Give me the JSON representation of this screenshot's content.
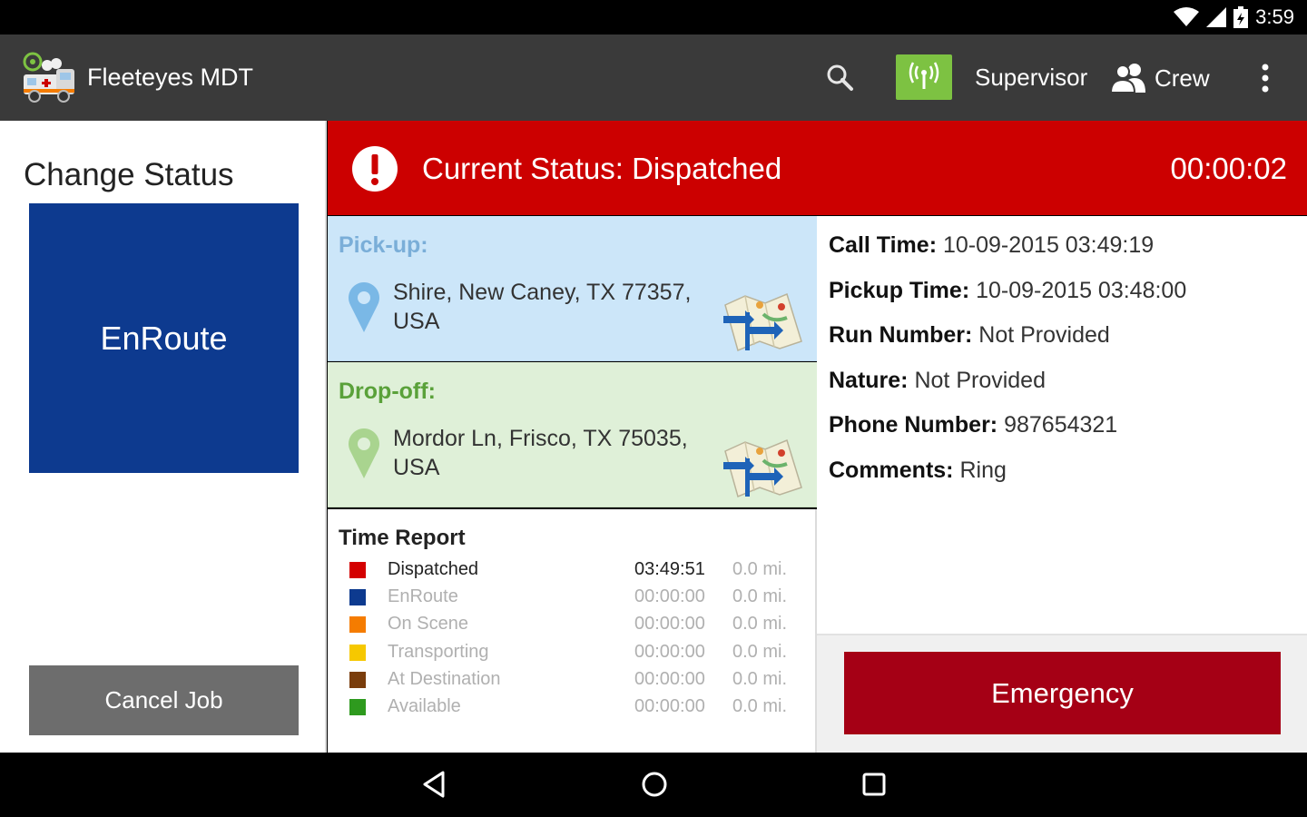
{
  "status_bar": {
    "time": "3:59",
    "icons": [
      "wifi-icon",
      "cell-signal-icon",
      "battery-icon"
    ]
  },
  "app_bar": {
    "title": "Fleeteyes MDT",
    "logo_icon": "ambulance-logo-icon",
    "search_icon": "search-icon",
    "signal_icon": "wireless-signal-icon",
    "supervisor_label": "Supervisor",
    "crew_label": "Crew",
    "overflow_icon": "more-vert-icon"
  },
  "left_panel": {
    "title": "Change Status",
    "next_status_button": "EnRoute",
    "cancel_button": "Cancel Job"
  },
  "banner": {
    "status_text": "Current Status: Dispatched",
    "timer": "00:00:02",
    "color": "#cc0000"
  },
  "pickup": {
    "label": "Pick-up:",
    "address_line1": "Shire, New Caney, TX 77357,",
    "address_line2": "USA"
  },
  "dropoff": {
    "label": "Drop-off:",
    "address_line1": "Mordor Ln, Frisco, TX 75035,",
    "address_line2": "USA"
  },
  "time_report": {
    "title": "Time Report",
    "rows": [
      {
        "name": "Dispatched",
        "time": "03:49:51",
        "distance": "0.0 mi.",
        "color": "#d40000"
      },
      {
        "name": "EnRoute",
        "time": "00:00:00",
        "distance": "0.0 mi.",
        "color": "#0d3a8f"
      },
      {
        "name": "On Scene",
        "time": "00:00:00",
        "distance": "0.0 mi.",
        "color": "#f57c00"
      },
      {
        "name": "Transporting",
        "time": "00:00:00",
        "distance": "0.0 mi.",
        "color": "#f6c800"
      },
      {
        "name": "At Destination",
        "time": "00:00:00",
        "distance": "0.0 mi.",
        "color": "#7a3d0c"
      },
      {
        "name": "Available",
        "time": "00:00:00",
        "distance": "0.0 mi.",
        "color": "#2e9a1e"
      }
    ]
  },
  "details": {
    "call_time_label": "Call Time:",
    "call_time_value": "10-09-2015  03:49:19",
    "pickup_time_label": "Pickup Time:",
    "pickup_time_value": "10-09-2015  03:48:00",
    "run_number_label": "Run Number:",
    "run_number_value": "Not Provided",
    "nature_label": "Nature:",
    "nature_value": "Not Provided",
    "phone_label": "Phone Number:",
    "phone_value": "987654321",
    "comments_label": "Comments:",
    "comments_value": "Ring"
  },
  "emergency_button": "Emergency",
  "nav_bar": {
    "icons": [
      "back-icon",
      "home-icon",
      "recents-icon"
    ]
  }
}
